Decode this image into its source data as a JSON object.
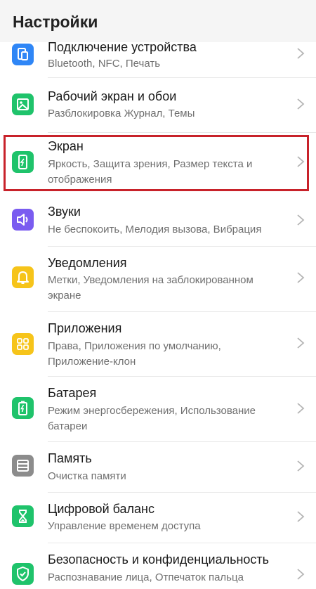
{
  "header": {
    "title": "Настройки"
  },
  "items": [
    {
      "title": "Подключение устройства",
      "sub1": "Bluetooth, NFC, Печать",
      "sub2": "",
      "icon": "device-connection-icon",
      "color": "#2f86f6"
    },
    {
      "title": "Рабочий экран и обои",
      "sub1": "Разблокировка Журнал, Темы",
      "sub2": "",
      "icon": "wallpaper-icon",
      "color": "#1fc36b"
    },
    {
      "title": "Экран",
      "sub1": "Яркость, Защита зрения, Размер текста и",
      "sub2": "отображения",
      "icon": "display-icon",
      "color": "#1fc36b"
    },
    {
      "title": "Звуки",
      "sub1": "Не беспокоить, Мелодия вызова, Вибрация",
      "sub2": "",
      "icon": "sound-icon",
      "color": "#7a5cf0"
    },
    {
      "title": "Уведомления",
      "sub1": "Метки, Уведомления на заблокированном",
      "sub2": "экране",
      "icon": "bell-icon",
      "color": "#f6c41a"
    },
    {
      "title": "Приложения",
      "sub1": "Права, Приложения по умолчанию,",
      "sub2": "Приложение-клон",
      "icon": "apps-icon",
      "color": "#f6c41a"
    },
    {
      "title": "Батарея",
      "sub1": "Режим энергосбережения, Использование",
      "sub2": "батареи",
      "icon": "battery-icon",
      "color": "#1fc36b"
    },
    {
      "title": "Память",
      "sub1": "Очистка памяти",
      "sub2": "",
      "icon": "storage-icon",
      "color": "#8c8c8c"
    },
    {
      "title": "Цифровой баланс",
      "sub1": "Управление временем доступа",
      "sub2": "",
      "icon": "hourglass-icon",
      "color": "#1fc36b"
    },
    {
      "title": "Безопасность и конфиденциальность",
      "sub1": "Распознавание лица, Отпечаток пальца",
      "sub2": "",
      "icon": "shield-icon",
      "color": "#1fc36b"
    }
  ]
}
